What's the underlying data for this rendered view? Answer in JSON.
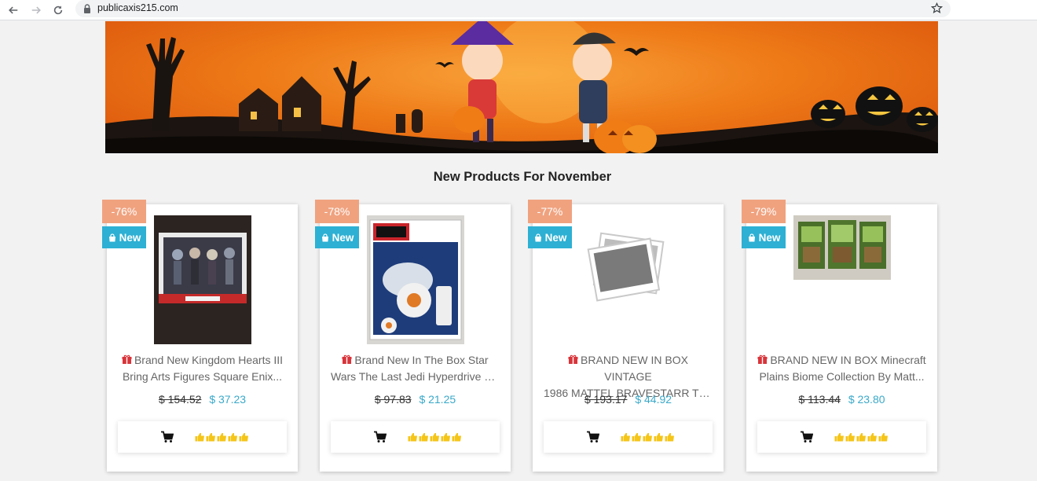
{
  "browser": {
    "url": "publicaxis215.com"
  },
  "section": {
    "title": "New Products For November"
  },
  "products": [
    {
      "discount": "-76%",
      "badge": "New",
      "title_line1": "Brand New Kingdom Hearts III",
      "title_line2": "Bring Arts Figures Square Enix...",
      "old_price": "$ 154.52",
      "new_price": "$ 37.23",
      "rating": 5
    },
    {
      "discount": "-78%",
      "badge": "New",
      "title_line1": "Brand New In The Box Star",
      "title_line2": "Wars The Last Jedi Hyperdrive B...",
      "old_price": "$ 97.83",
      "new_price": "$ 21.25",
      "rating": 5
    },
    {
      "discount": "-77%",
      "badge": "New",
      "title_line1": "BRAND NEW IN BOX VINTAGE",
      "title_line2": "1986 MATTEL BRAVESTARR TEX...",
      "old_price": "$ 193.17",
      "new_price": "$ 44.92",
      "rating": 5
    },
    {
      "discount": "-79%",
      "badge": "New",
      "title_line1": "BRAND NEW IN BOX Minecraft",
      "title_line2": "Plains Biome Collection By Matt...",
      "old_price": "$ 113.44",
      "new_price": "$ 23.80",
      "rating": 5
    }
  ],
  "colors": {
    "discount_bg": "#f0a27f",
    "new_badge_bg": "#2db0d3",
    "price_accent": "#3aa9c9",
    "gift_icon": "#d9343a",
    "rating_icon": "#f5c518"
  }
}
